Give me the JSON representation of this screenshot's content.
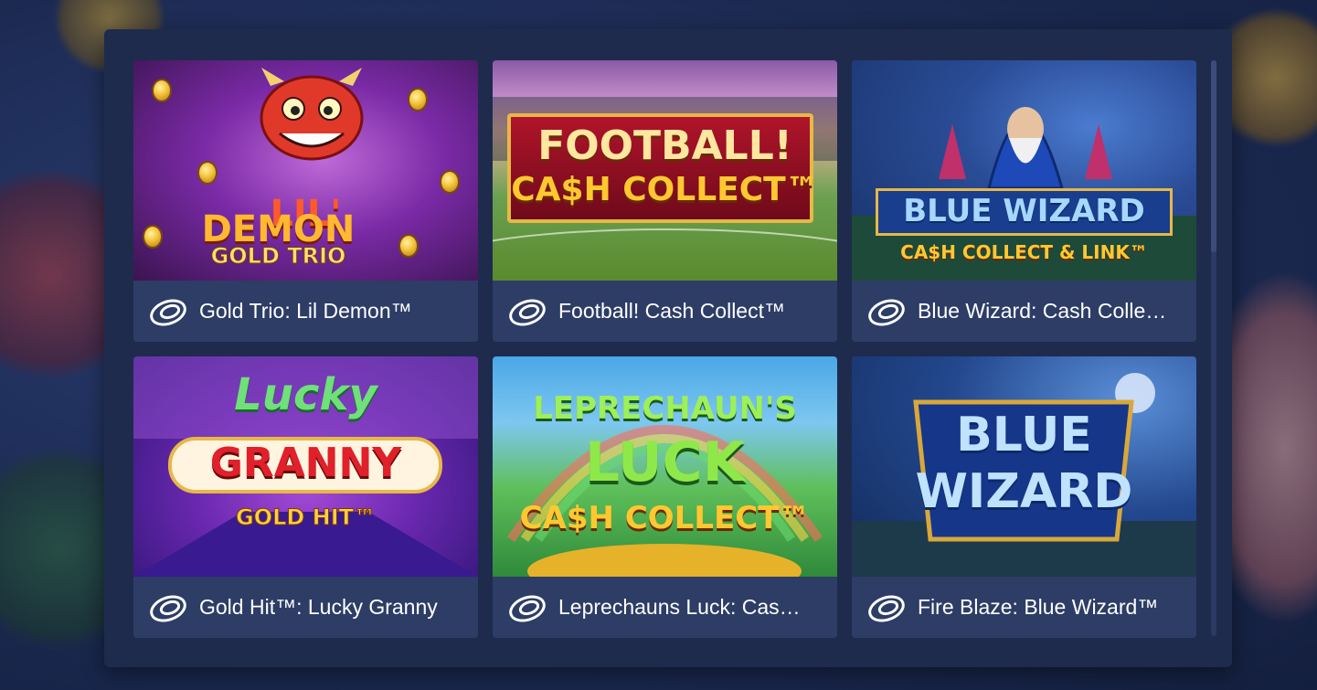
{
  "colors": {
    "page_bg": "#1c2a52",
    "panel_bg": "#1f2b4d",
    "caption_bg": "#2d3d66",
    "title_text": "#ffffff"
  },
  "provider_icon": "playtech-logo-icon",
  "games": [
    {
      "title": "Gold Trio: Lil Demon™",
      "art": {
        "line1": "LIL'",
        "line2": "DEMON",
        "line3": "GOLD TRIO"
      }
    },
    {
      "title": "Football! Cash Collect™",
      "art": {
        "line1": "FOOTBALL!",
        "line2": "CA$H COLLECT™"
      }
    },
    {
      "title": "Blue Wizard: Cash Colle…",
      "art": {
        "line1": "BLUE WIZARD",
        "line2": "CA$H COLLECT & LINK™"
      }
    },
    {
      "title": "Gold Hit™: Lucky Granny",
      "art": {
        "line1": "Lucky",
        "line2": "GRANNY",
        "line3": "GOLD HIT™"
      }
    },
    {
      "title": "Leprechauns Luck: Cas…",
      "art": {
        "line1": "LEPRECHAUN'S",
        "line2": "LUCK",
        "line3": "CA$H COLLECT™"
      }
    },
    {
      "title": "Fire Blaze: Blue Wizard™",
      "art": {
        "line1": "BLUE",
        "line2": "WIZARD"
      }
    }
  ]
}
